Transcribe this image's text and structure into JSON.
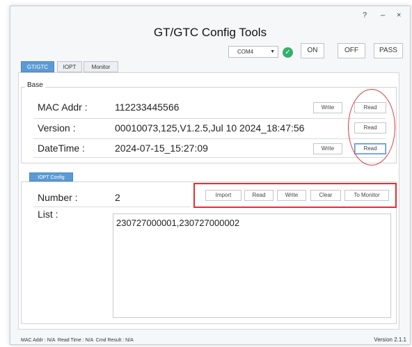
{
  "window": {
    "title": "GT/GTC Config Tools",
    "controls": {
      "help": "?",
      "minimize": "–",
      "close": "×"
    }
  },
  "toolbar": {
    "com_port": "COM4",
    "connection_status_icon": "check-circle-icon",
    "on_label": "ON",
    "off_label": "OFF",
    "pass_label": "PASS"
  },
  "tabs": [
    {
      "label": "GT/GTC",
      "active": true
    },
    {
      "label": "IOPT",
      "active": false
    },
    {
      "label": "Monitor",
      "active": false
    }
  ],
  "base": {
    "group_label": "Base",
    "rows": [
      {
        "label": "MAC Addr :",
        "value": "112233445566",
        "write_label": "Write",
        "read_label": "Read"
      },
      {
        "label": "Version :",
        "value": "00010073,125,V1.2.5,Jul 10 2024_18:47:56",
        "read_label": "Read"
      },
      {
        "label": "DateTime :",
        "value": "2024-07-15_15:27:09",
        "write_label": "Write",
        "read_label": "Read"
      }
    ]
  },
  "iopt": {
    "tab_label": "IOPT Config",
    "number_label": "Number :",
    "number_value": "2",
    "buttons": {
      "import": "Import",
      "read": "Read",
      "write": "Write",
      "clear": "Clear",
      "to_monitor": "To Monitor"
    },
    "list_label": "List :",
    "list_value": "230727000001,230727000002"
  },
  "status_bar": {
    "text": "MAC Addr : N/A  Read Time : N/A  Cmd Result : N/A",
    "version": "Version  2.1.1"
  },
  "colors": {
    "accent": "#5b9bd5",
    "highlight_red": "#e03030",
    "ok_green": "#33b06a"
  }
}
